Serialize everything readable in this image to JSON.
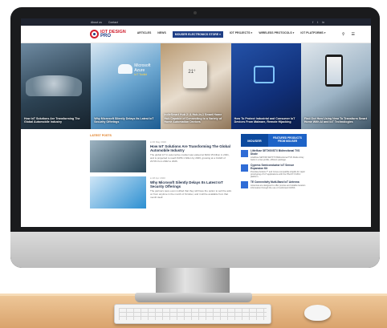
{
  "site": {
    "topbar": {
      "links": [
        "About us",
        "Contact"
      ],
      "social": [
        "f",
        "t",
        "in"
      ]
    },
    "logo": {
      "line1": "IOT DESIGN",
      "line2": "PRO"
    },
    "nav": {
      "items": [
        "ARTICLES",
        "NEWS",
        "MOUSER ELECTRONICS STORE ▾",
        "IOT PROJECTS ▾",
        "WIRELESS PROTOCOLS ▾",
        "IOT PLATFORMS ▾"
      ],
      "icons": [
        "search-icon",
        "menu-icon"
      ]
    },
    "hero": [
      {
        "caption": "How IoT Solutions Are Transforming The Global Automobile Industry"
      },
      {
        "caption": "Why Microsoft Silently Delays Its Latest IoT Security Offerings",
        "logo_text": "Microsoft Azure",
        "logo_sub": "IoT Toolkit"
      },
      {
        "caption": "IndieSmart Hub 2: A Hub-in-1 Smart Home Hub Capable of Connecting to a Variety of Home Automation Devices"
      },
      {
        "caption": "How To Protect Industrial and Consumer IoT Devices From Malware, Remote Hijacking"
      },
      {
        "caption": "Find Out How Using Near To Transform Smart Home With AI and IoT Technologies"
      }
    ],
    "latest": {
      "title": "LATEST POSTS",
      "posts": [
        {
          "date": "● 06 May 2020",
          "title": "How IoT Solutions Are Transforming The Global Automobile Industry",
          "excerpt": "The global IoT in automotive market was valued at $102.15 billion in 2021, and is projected to reach $156.1 billion by 2026, growing at a CAGR of 23.5% from 2022 to 2026."
        },
        {
          "date": "● 28 Apr 2020",
          "title": "Why Microsoft Silently Delays Its Latest IoT Security Offerings",
          "excerpt": "The partners were even notified that they will have the option to sell the add-on from anytime in the month of October, and it will be available from that month itself."
        }
      ]
    },
    "sidebar": {
      "mouser_logo": "MOUSER",
      "mouser_caption": "FEATURED PRODUCTS FROM MOUSER",
      "products": [
        {
          "title": "Littelfuse SETX00/STX Bidirectional TVS Diode",
          "desc": "Littelfuse SETX00 SETXTX Bidirectional TVS Diode Array bank in a low-profile, efficient package."
        },
        {
          "title": "Cypress Semiconductor IoT Sensor Expansion Kit",
          "desc": "Provides Arduino™ and Grove-compatible shields for rapid prototyping of IoT applications with the PSoC® 6 MCU platform."
        },
        {
          "title": "TE Connectivity Multi-Band IoT Antenna",
          "desc": "Antennas are designed to offer precise and reliable location information through the use of multi-band GNSS."
        }
      ]
    }
  },
  "colors": {
    "brand_red": "#d01f2f",
    "brand_blue": "#1f3f86",
    "accent_orange": "#e07a1c",
    "mouser_blue": "#0d4a9e"
  }
}
